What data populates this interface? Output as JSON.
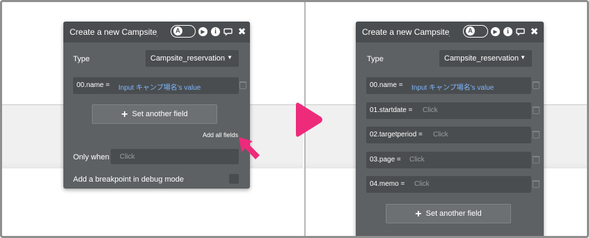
{
  "left_panel": {
    "title": "Create a new Campsite_r",
    "type_label": "Type",
    "type_value": "Campsite_reservation",
    "fields": [
      {
        "name": "00.name =",
        "value": "Input キャンプ場名's value"
      }
    ],
    "set_another_field": "Set another field",
    "add_all_fields": "Add all fields",
    "only_when_label": "Only when",
    "only_when_placeholder": "Click",
    "breakpoint_label": "Add a breakpoint in debug mode"
  },
  "right_panel": {
    "title": "Create a new Campsite_r",
    "type_label": "Type",
    "type_value": "Campsite_reservation",
    "fields": [
      {
        "name": "00.name =",
        "value": "Input キャンプ場名's value"
      },
      {
        "name": "01.startdate =",
        "value": "Click"
      },
      {
        "name": "02.targetperiod =",
        "value": "Click"
      },
      {
        "name": "03.page =",
        "value": "Click"
      },
      {
        "name": "04.memo =",
        "value": "Click"
      }
    ],
    "set_another_field": "Set another field"
  },
  "icons": {
    "user_toggle": "user-toggle-icon",
    "play": "play-icon",
    "info": "info-icon",
    "comment": "comment-icon",
    "close": "close-icon",
    "trash": "trash-icon",
    "cursor": "pointer-cursor-icon",
    "transition": "right-arrow-icon"
  },
  "colors": {
    "panel_bg": "#5d6163",
    "titlebar_bg": "#4a4d4f",
    "dynamic_value": "#7db6ff",
    "placeholder": "#9a9ea0",
    "highlight_arrow": "#ee2a7b"
  }
}
